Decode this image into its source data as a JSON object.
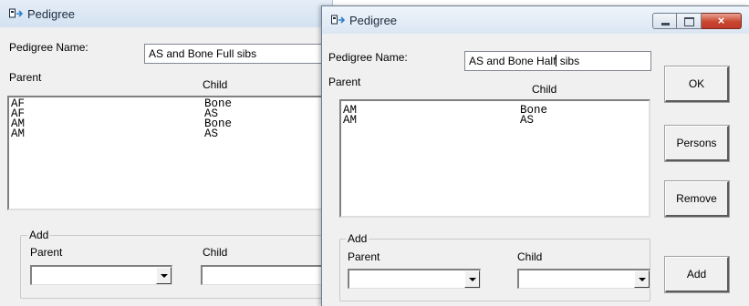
{
  "colors": {
    "titlebar": "#dbe6f3",
    "window_bg": "#f0f0f0",
    "close_button": "#c9462f"
  },
  "window1": {
    "title": "Pedigree",
    "pedigree_name_label": "Pedigree Name:",
    "pedigree_name_value": "AS and Bone Full sibs",
    "parent_header": "Parent",
    "child_header": "Child",
    "rows": [
      {
        "parent": "AF",
        "child": "Bone"
      },
      {
        "parent": "AF",
        "child": "AS"
      },
      {
        "parent": "AM",
        "child": "Bone"
      },
      {
        "parent": "AM",
        "child": "AS"
      }
    ],
    "add_group_label": "Add",
    "add_parent_label": "Parent",
    "add_child_label": "Child"
  },
  "window2": {
    "title": "Pedigree",
    "pedigree_name_label": "Pedigree Name:",
    "pedigree_name_before_caret": "AS and Bone Half",
    "pedigree_name_after_caret": " sibs",
    "parent_header": "Parent",
    "child_header": "Child",
    "rows": [
      {
        "parent": "AM",
        "child": "Bone"
      },
      {
        "parent": "AM",
        "child": "AS"
      }
    ],
    "add_group_label": "Add",
    "add_parent_label": "Parent",
    "add_child_label": "Child",
    "ok_label": "OK",
    "persons_label": "Persons",
    "remove_label": "Remove",
    "add_label": "Add",
    "close_glyph": "×"
  }
}
